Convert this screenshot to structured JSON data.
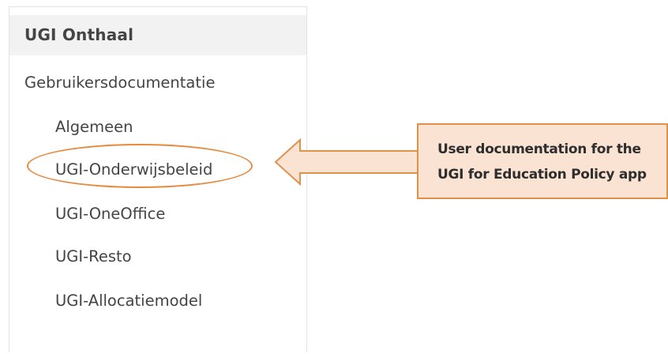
{
  "nav": {
    "header": "UGI Onthaal",
    "section": "Gebruikersdocumentatie",
    "items": [
      "Algemeen",
      "UGI-Onderwijsbeleid",
      "UGI-OneOffice",
      "UGI-Resto",
      "UGI-Allocatiemodel"
    ]
  },
  "callout": {
    "line1": "User documentation for the",
    "line2": "UGI for Education Policy app"
  },
  "colors": {
    "accent_stroke": "#e0924d",
    "callout_fill": "#fbe3d3",
    "header_bg": "#f2f2f2"
  }
}
